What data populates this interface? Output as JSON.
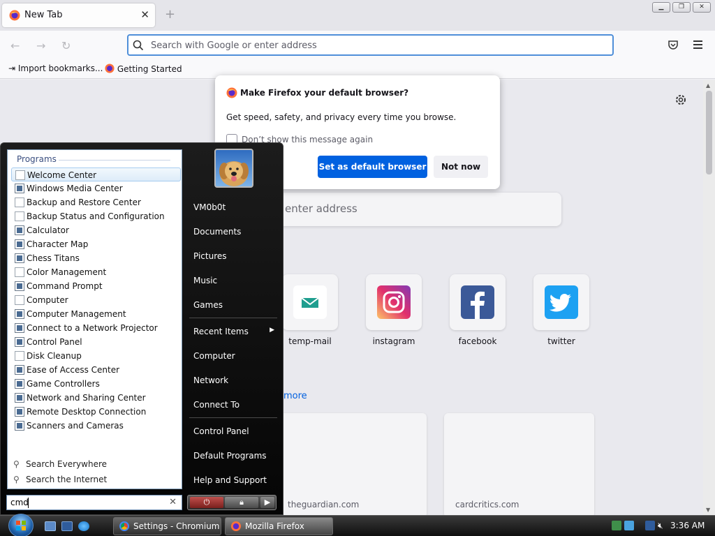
{
  "browser": {
    "tab_title": "New Tab",
    "url_placeholder": "Search with Google or enter address",
    "bookmarks": [
      "Import bookmarks...",
      "Getting Started"
    ]
  },
  "newtab": {
    "search_placeholder": "enter address",
    "top_sites": [
      {
        "label": "temp-mail",
        "color": "#1f9e8f",
        "icon": "temp-mail-icon"
      },
      {
        "label": "instagram",
        "color": "#d6249f",
        "icon": "instagram-icon"
      },
      {
        "label": "facebook",
        "color": "#3b5998",
        "icon": "facebook-icon"
      },
      {
        "label": "twitter",
        "color": "#1da1f2",
        "icon": "twitter-icon"
      }
    ],
    "show_more": "more",
    "cards": [
      "theguardian.com",
      "cardcritics.com"
    ]
  },
  "dialog": {
    "title": "Make Firefox your default browser?",
    "body": "Get speed, safety, and privacy every time you browse.",
    "checkbox_label": "Don’t show this message again",
    "primary_button": "Set as default browser",
    "secondary_button": "Not now"
  },
  "start_menu": {
    "programs_header": "Programs",
    "programs": [
      {
        "label": "Welcome Center",
        "icon": "doc",
        "selected": true
      },
      {
        "label": "Windows Media Center",
        "icon": "win"
      },
      {
        "label": "Backup and Restore Center",
        "icon": "doc"
      },
      {
        "label": "Backup Status and Configuration",
        "icon": "doc"
      },
      {
        "label": "Calculator",
        "icon": "win"
      },
      {
        "label": "Character Map",
        "icon": "win"
      },
      {
        "label": "Chess Titans",
        "icon": "win"
      },
      {
        "label": "Color Management",
        "icon": "doc"
      },
      {
        "label": "Command Prompt",
        "icon": "win"
      },
      {
        "label": "Computer",
        "icon": "doc"
      },
      {
        "label": "Computer Management",
        "icon": "win"
      },
      {
        "label": "Connect to a Network Projector",
        "icon": "win"
      },
      {
        "label": "Control Panel",
        "icon": "win"
      },
      {
        "label": "Disk Cleanup",
        "icon": "doc"
      },
      {
        "label": "Ease of Access Center",
        "icon": "win"
      },
      {
        "label": "Game Controllers",
        "icon": "win"
      },
      {
        "label": "Network and Sharing Center",
        "icon": "win"
      },
      {
        "label": "Remote Desktop Connection",
        "icon": "win"
      },
      {
        "label": "Scanners and Cameras",
        "icon": "win"
      }
    ],
    "search_everywhere": "Search Everywhere",
    "search_internet": "Search the Internet",
    "search_value": "cmd",
    "user_name": "VM0b0t",
    "right_items": [
      "Documents",
      "Pictures",
      "Music",
      "Games",
      "Recent Items",
      "Computer",
      "Network",
      "Connect To",
      "Control Panel",
      "Default Programs",
      "Help and Support"
    ]
  },
  "taskbar": {
    "tasks": [
      "Settings - Chromium",
      "Mozilla Firefox"
    ],
    "clock": "3:36 AM"
  }
}
